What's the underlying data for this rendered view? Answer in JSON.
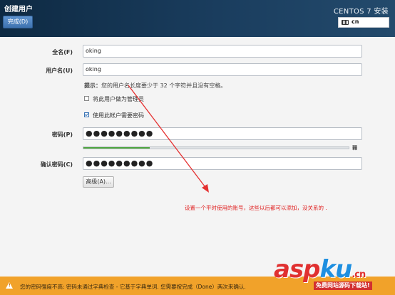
{
  "header": {
    "title": "创建用户",
    "done_button": "完成(D)",
    "product_title": "CENTOS 7 安装",
    "keyboard_layout": "cn"
  },
  "form": {
    "fullname_label": "全名(F)",
    "fullname_value": "oking",
    "username_label": "用户名(U)",
    "username_value": "oking",
    "hint_head": "提示：",
    "hint_text": "您的用户名长度要少于 32 个字符并且没有空格。",
    "admin_checkbox_label": "将此用户做为管理员",
    "admin_checked": false,
    "require_password_label": "使用此帐户需要密码",
    "require_password_checked": true,
    "password_label": "密码(P)",
    "password_value": "●●●●●●●●●",
    "strength_label": "弱",
    "strength_level": 0.25,
    "strength_color": "#4ea540",
    "confirm_label": "确认密码(C)",
    "confirm_value": "●●●●●●●●●",
    "advanced_button": "高级(A)..."
  },
  "annotation": {
    "text": "设置一个平时使用的账号，这些以后都可以添加，没关系的 .",
    "color": "#e02020"
  },
  "warning": {
    "text": "您的密码强度不高: 密码未通过字典检查 - 它基于字典单词. 您需要按完成（Done）两次来确认.",
    "icon": "warning-icon"
  },
  "watermark": {
    "logo_asp": "asp",
    "logo_ku": "ku",
    "logo_cn": ".cn",
    "subtitle": "免费网站源码下载站!"
  }
}
